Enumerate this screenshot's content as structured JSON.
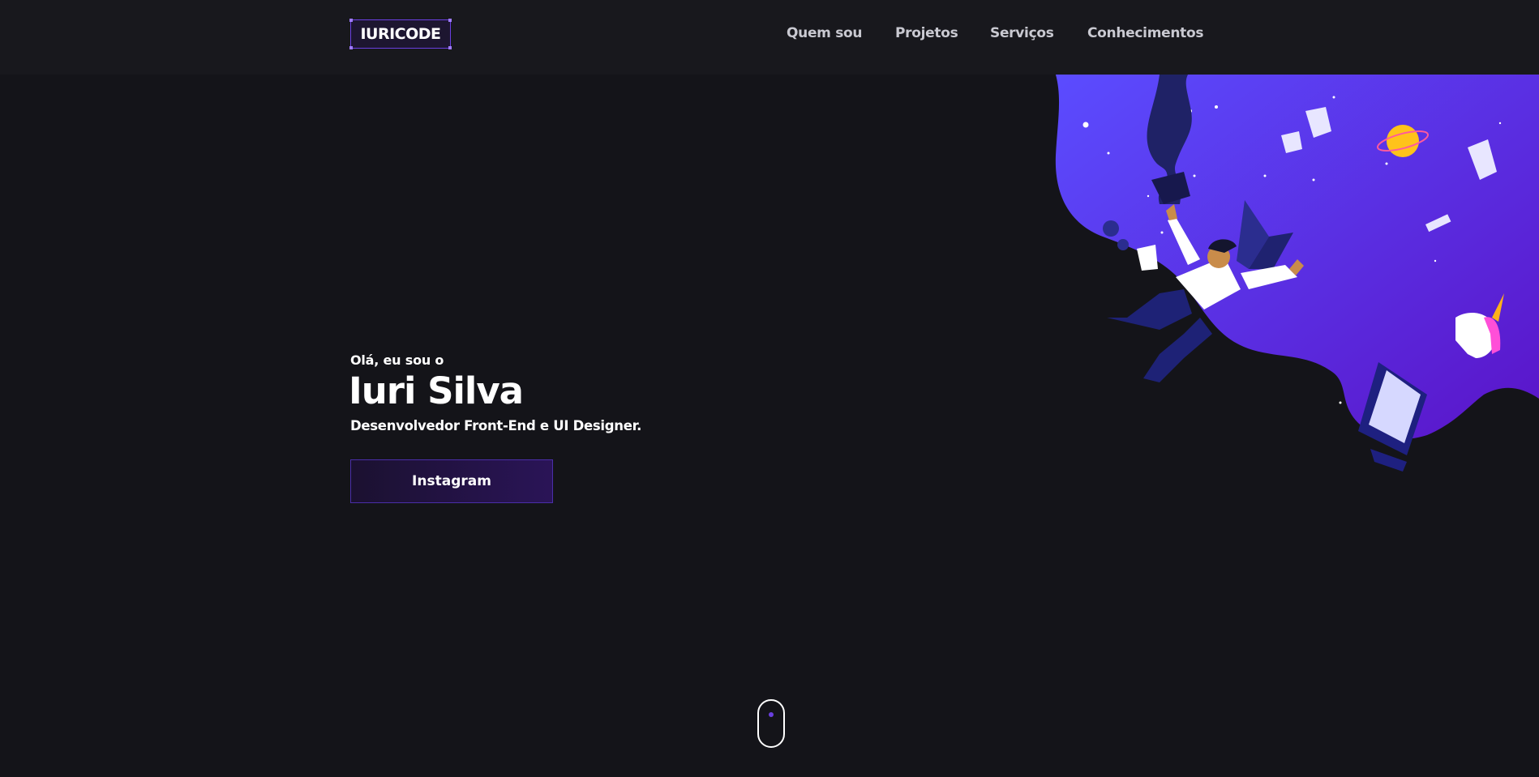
{
  "header": {
    "logo": "IURICODE",
    "nav": [
      "Quem sou",
      "Projetos",
      "Serviços",
      "Conhecimentos"
    ]
  },
  "hero": {
    "greeting": "Olá, eu sou o",
    "name": "Iuri Silva",
    "role": "Desenvolvedor Front-End e UI Designer.",
    "button": "Instagram"
  },
  "colors": {
    "background": "#141419",
    "header": "#18181d",
    "accent": "#6a3fe0",
    "illustration_gradient": [
      "#5b4cff",
      "#5a14c8"
    ]
  },
  "icons": [
    "scroll-mouse-icon"
  ]
}
